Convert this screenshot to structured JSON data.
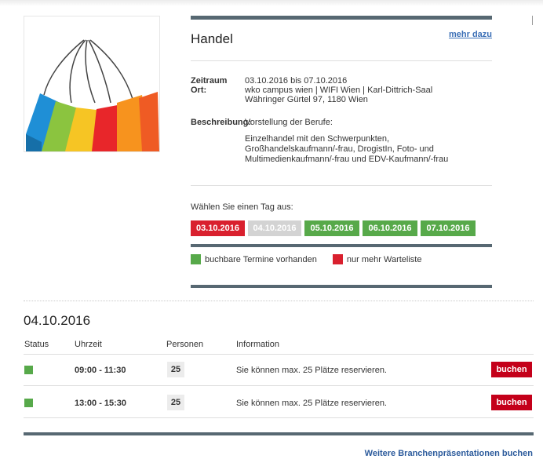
{
  "event": {
    "title": "Handel",
    "more_link": "mehr dazu",
    "zeitraum_label": "Zeitraum",
    "zeitraum_value": "03.10.2016 bis 07.10.2016",
    "ort_label": "Ort:",
    "ort_line1": "wko campus wien | WIFI Wien | Karl-Dittrich-Saal",
    "ort_line2": "Währinger Gürtel 97, 1180 Wien",
    "beschreibung_label": "Beschreibung:",
    "beschreibung_intro": "Vorstellung der Berufe:",
    "beschreibung_text": "Einzelhandel mit den Schwerpunkten, Großhandelskaufmann/-frau, DrogistIn, Foto- und Multimedienkaufmann/-frau und EDV-Kaufmann/-frau"
  },
  "day_chooser": {
    "label": "Wählen Sie einen Tag aus:",
    "days": [
      {
        "label": "03.10.2016",
        "state": "waitlist",
        "color": "#d9202e"
      },
      {
        "label": "04.10.2016",
        "state": "selected",
        "color": "#d3d3d3"
      },
      {
        "label": "05.10.2016",
        "state": "available",
        "color": "#57a94a"
      },
      {
        "label": "06.10.2016",
        "state": "available",
        "color": "#57a94a"
      },
      {
        "label": "07.10.2016",
        "state": "available",
        "color": "#57a94a"
      }
    ]
  },
  "legend": {
    "available": {
      "label": "buchbare Termine vorhanden",
      "color": "#57a94a"
    },
    "waitlist": {
      "label": "nur mehr Warteliste",
      "color": "#d9202e"
    }
  },
  "schedule": {
    "date": "04.10.2016",
    "headers": {
      "status": "Status",
      "time": "Uhrzeit",
      "persons": "Personen",
      "info": "Information"
    },
    "rows": [
      {
        "status_color": "#57a94a",
        "time": "09:00 - 11:30",
        "persons": "25",
        "info": "Sie können max. 25 Plätze reservieren.",
        "action": "buchen"
      },
      {
        "status_color": "#57a94a",
        "time": "13:00 - 15:30",
        "persons": "25",
        "info": "Sie können max. 25 Plätze reservieren.",
        "action": "buchen"
      }
    ]
  },
  "footer": {
    "link": "Weitere Branchenpräsentationen buchen"
  },
  "icons": {
    "event_image": "shopping-bags-image"
  }
}
